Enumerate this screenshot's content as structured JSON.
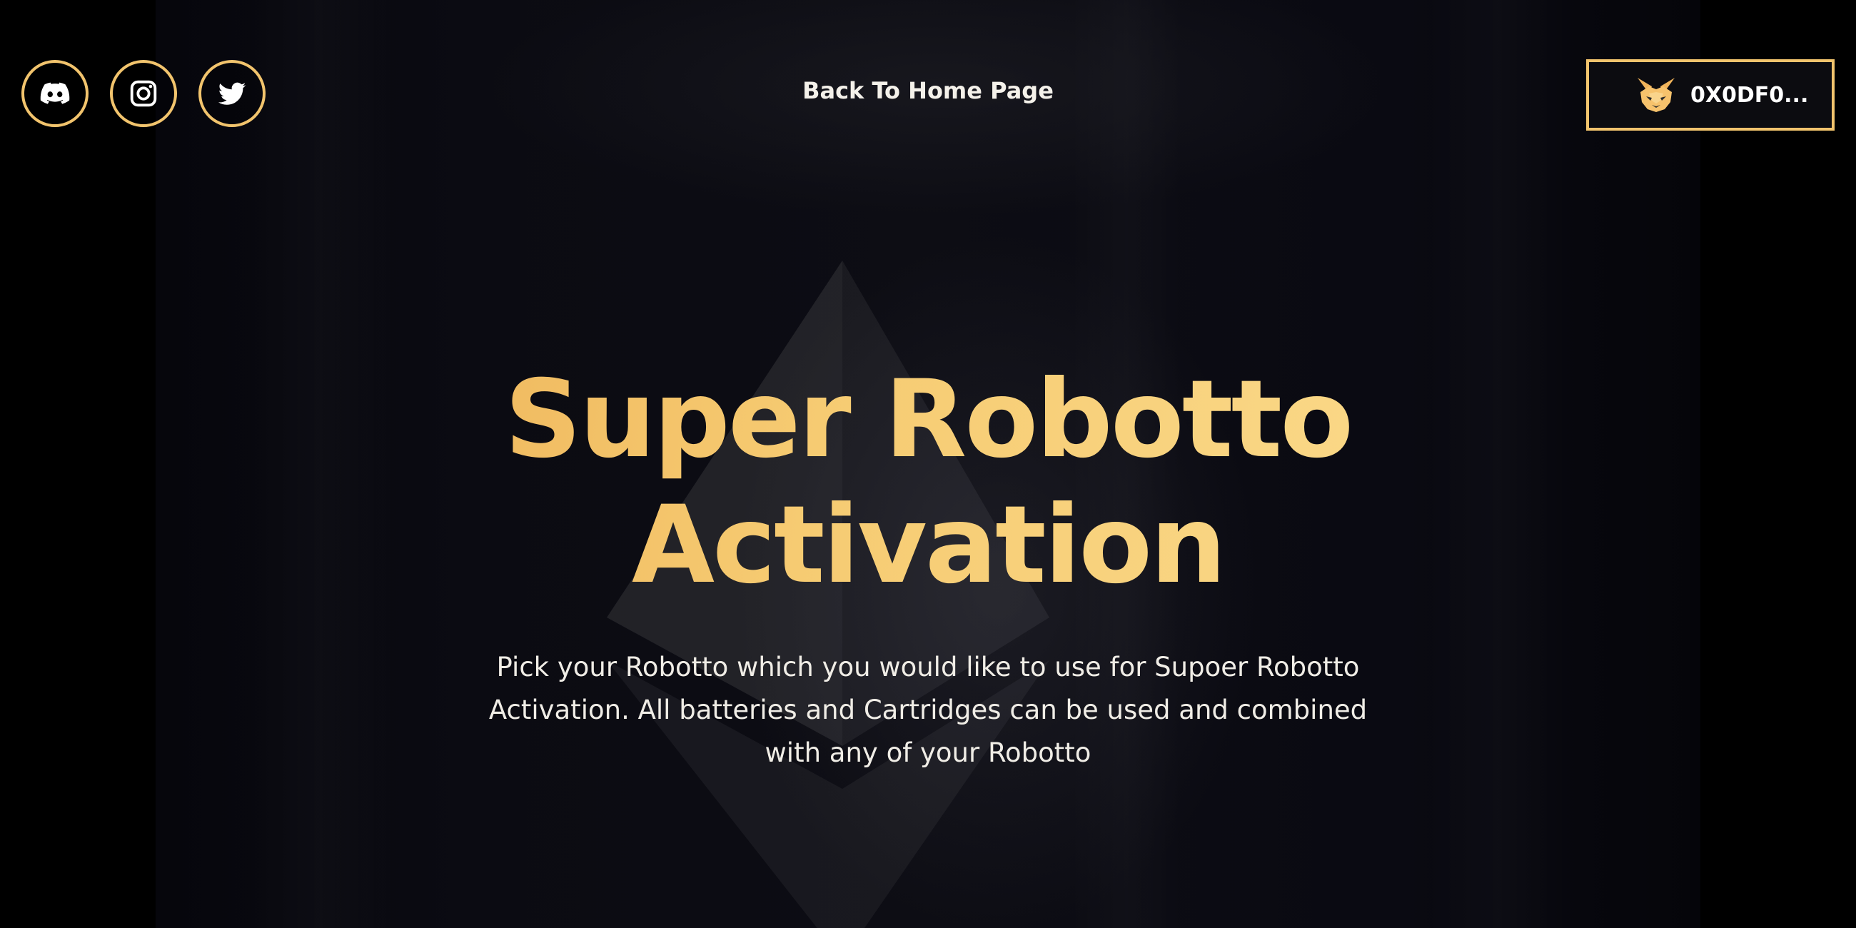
{
  "colors": {
    "accent": "#f2c46d",
    "title_gradient_start": "#eeb55a",
    "title_gradient_end": "#fbdb8c",
    "background": "#000000",
    "text": "#f0ede6"
  },
  "header": {
    "social_links": [
      {
        "icon": "discord-icon"
      },
      {
        "icon": "instagram-icon"
      },
      {
        "icon": "twitter-icon"
      }
    ],
    "home_link_label": "Back To Home Page",
    "wallet": {
      "icon": "metamask-fox-icon",
      "address_label": "0X0DF0..."
    }
  },
  "hero": {
    "title_line1": "Super Robotto",
    "title_line2": "Activation",
    "description": "Pick your Robotto which you would like to use for Supoer Robotto Activation. All batteries and Cartridges can be used and combined with any of your Robotto"
  }
}
